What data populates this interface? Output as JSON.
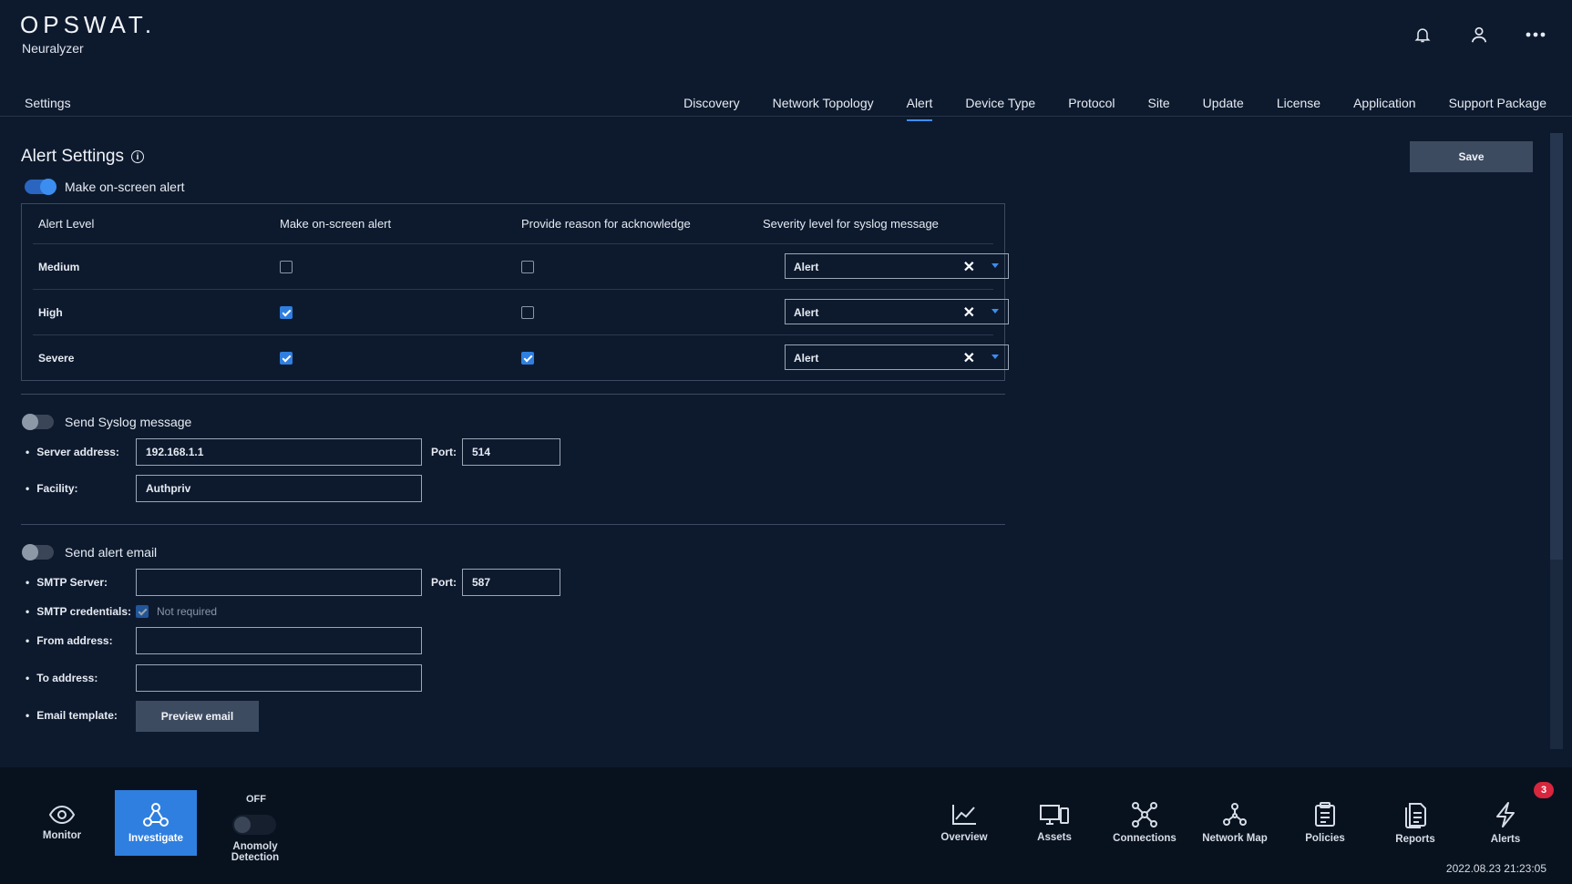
{
  "app": {
    "logo": "OPSWAT.",
    "product": "Neuralyzer"
  },
  "nav": {
    "section": "Settings",
    "tabs": [
      "Discovery",
      "Network Topology",
      "Alert",
      "Device Type",
      "Protocol",
      "Site",
      "Update",
      "License",
      "Application",
      "Support Package"
    ],
    "active_tab": "Alert"
  },
  "alert_settings": {
    "title": "Alert Settings",
    "save_label": "Save",
    "onscreen_toggle": {
      "label": "Make on-screen alert",
      "on": true
    },
    "table": {
      "headers": [
        "Alert Level",
        "Make on-screen alert",
        "Provide reason for acknowledge",
        "Severity level for syslog message"
      ],
      "rows": [
        {
          "level": "Medium",
          "onscreen": false,
          "reason": false,
          "severity": "Alert"
        },
        {
          "level": "High",
          "onscreen": true,
          "reason": false,
          "severity": "Alert"
        },
        {
          "level": "Severe",
          "onscreen": true,
          "reason": true,
          "severity": "Alert"
        }
      ]
    }
  },
  "syslog": {
    "toggle_label": "Send Syslog message",
    "on": false,
    "server_label": "Server address:",
    "server_value": "192.168.1.1",
    "port_label": "Port:",
    "port_value": "514",
    "facility_label": "Facility:",
    "facility_value": "Authpriv"
  },
  "email": {
    "toggle_label": "Send alert email",
    "on": false,
    "smtp_label": "SMTP Server:",
    "smtp_value": "",
    "port_label": "Port:",
    "port_value": "587",
    "cred_label": "SMTP credentials:",
    "cred_checkbox_label": "Not required",
    "cred_not_required": true,
    "from_label": "From address:",
    "from_value": "",
    "to_label": "To address:",
    "to_value": "",
    "template_label": "Email template:",
    "preview_label": "Preview email"
  },
  "bottom_nav": {
    "left": [
      {
        "label": "Monitor",
        "icon": "eye-icon"
      },
      {
        "label": "Investigate",
        "icon": "investigate-icon",
        "active": true
      }
    ],
    "anomaly": {
      "state": "OFF",
      "label": "Anomoly Detection"
    },
    "right": [
      {
        "label": "Overview",
        "icon": "chart-icon"
      },
      {
        "label": "Assets",
        "icon": "devices-icon"
      },
      {
        "label": "Connections",
        "icon": "connections-icon"
      },
      {
        "label": "Network Map",
        "icon": "network-map-icon"
      },
      {
        "label": "Policies",
        "icon": "clipboard-icon"
      },
      {
        "label": "Reports",
        "icon": "reports-icon"
      },
      {
        "label": "Alerts",
        "icon": "lightning-icon"
      }
    ],
    "alerts_badge": "3",
    "timestamp": "2022.08.23 21:23:05"
  },
  "colors": {
    "background": "#0d1a2e",
    "accent": "#2f7fe0",
    "badge": "#d7263d"
  }
}
